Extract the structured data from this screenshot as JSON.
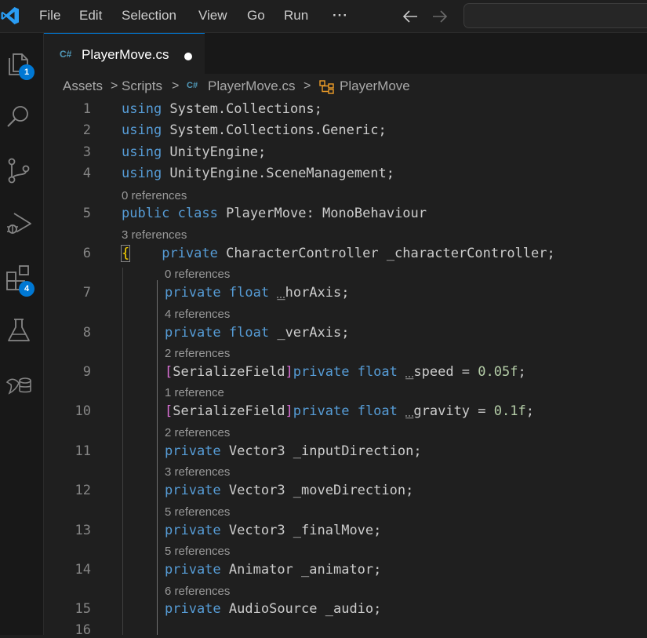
{
  "menu": {
    "items": [
      "File",
      "Edit",
      "Selection",
      "View",
      "Go",
      "Run"
    ],
    "more": "···"
  },
  "activity_bar": {
    "explorer_badge": "1",
    "extensions_badge": "4"
  },
  "tab": {
    "icon_text": "C#",
    "label": "PlayerMove.cs"
  },
  "breadcrumb": {
    "items": [
      "Assets",
      "Scripts",
      "PlayerMove.cs",
      "PlayerMove"
    ],
    "separator": ">"
  },
  "code": {
    "line_numbers": [
      "1",
      "2",
      "3",
      "4",
      "5",
      "6",
      "7",
      "8",
      "9",
      "10",
      "11",
      "12",
      "13",
      "14",
      "15",
      "16"
    ],
    "codelens": [
      "0 references",
      "3 references",
      "0 references",
      "4 references",
      "2 references",
      "1 reference",
      "2 references",
      "3 references",
      "5 references",
      "5 references",
      "6 references"
    ],
    "lines": {
      "l1": [
        "using",
        " System.Collections;"
      ],
      "l2": [
        "using",
        " System.Collections.Generic;"
      ],
      "l3": [
        "using",
        " UnityEngine;"
      ],
      "l4": [
        "using",
        " UnityEngine.SceneManagement;"
      ],
      "l5": [
        "public",
        " ",
        "class",
        " ",
        "PlayerMove",
        ": ",
        "MonoBehaviour"
      ],
      "l6": [
        "{",
        "    ",
        "private",
        " ",
        "CharacterController",
        " _characterController;"
      ],
      "l7": [
        "private",
        " ",
        "float",
        " ",
        "_",
        "horAxis;"
      ],
      "l8": [
        "private",
        " ",
        "float",
        " _verAxis;"
      ],
      "l9": [
        "[",
        "SerializeField",
        "]",
        "private",
        " ",
        "float",
        " ",
        "_",
        "speed = ",
        "0.05f",
        ";"
      ],
      "l10": [
        "[",
        "SerializeField",
        "]",
        "private",
        " ",
        "float",
        " ",
        "_",
        "gravity = ",
        "0.1f",
        ";"
      ],
      "l11": [
        "private",
        " ",
        "Vector3",
        " _inputDirection;"
      ],
      "l12": [
        "private",
        " ",
        "Vector3",
        " _moveDirection;"
      ],
      "l13": [
        "private",
        " ",
        "Vector3",
        " _finalMove;"
      ],
      "l14": [
        "private",
        " ",
        "Animator",
        " _animator;"
      ],
      "l15": [
        "private",
        " ",
        "AudioSource",
        " _audio;"
      ]
    }
  },
  "colors": {
    "accent": "#0078d4",
    "keyword": "#569cd6",
    "type": "#4ec9b0",
    "number": "#b5cea8",
    "bracket_gold": "#ffd700",
    "bracket_purple": "#da70d6"
  }
}
